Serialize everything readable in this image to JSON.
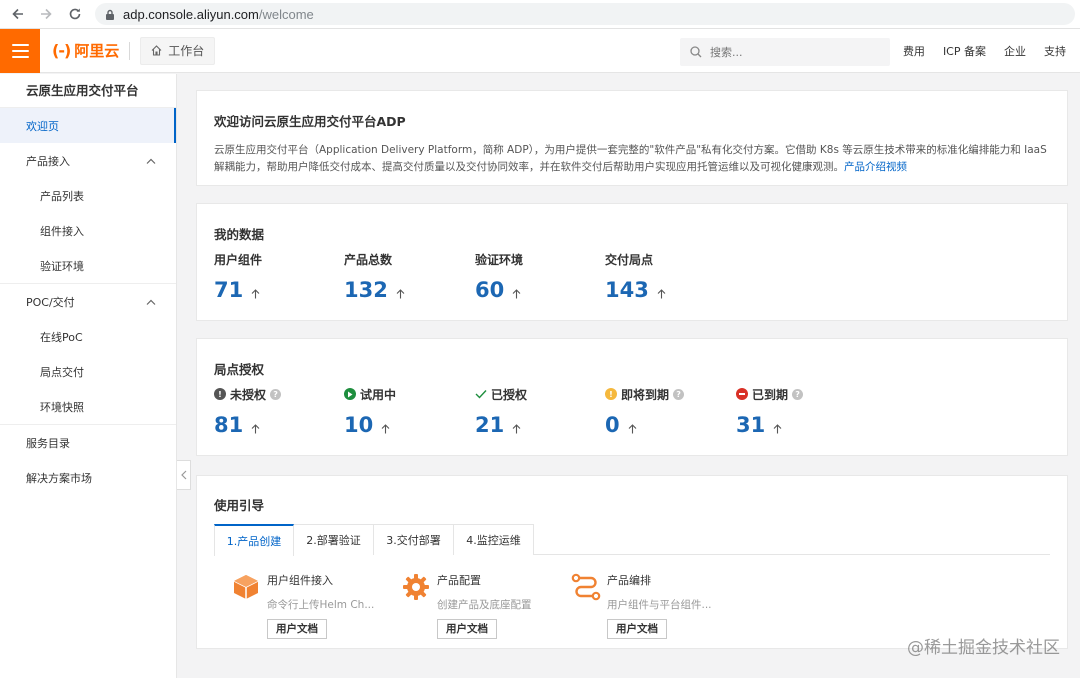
{
  "browser": {
    "url_host": "adp.console.aliyun.com",
    "url_path": "/welcome"
  },
  "topnav": {
    "logo_mark": "(-)",
    "logo_text": "阿里云",
    "workbench_label": "工作台",
    "search_placeholder": "搜索...",
    "links": [
      "费用",
      "ICP 备案",
      "企业",
      "支持"
    ]
  },
  "sidebar": {
    "title": "云原生应用交付平台",
    "items": [
      {
        "label": "欢迎页",
        "active": true
      },
      {
        "label": "产品接入",
        "group": true
      },
      {
        "label": "产品列表"
      },
      {
        "label": "组件接入"
      },
      {
        "label": "验证环境"
      },
      {
        "label": "POC/交付",
        "group": true
      },
      {
        "label": "在线PoC"
      },
      {
        "label": "局点交付"
      },
      {
        "label": "环境快照"
      },
      {
        "label": "服务目录"
      },
      {
        "label": "解决方案市场"
      }
    ]
  },
  "welcome": {
    "title": "欢迎访问云原生应用交付平台ADP",
    "body": "云原生应用交付平台（Application Delivery Platform，简称 ADP），为用户提供一套完整的\"软件产品\"私有化交付方案。它借助 K8s 等云原生技术带来的标准化编排能力和 IaaS 解耦能力，帮助用户降低交付成本、提高交付质量以及交付协同效率，并在软件交付后帮助用户实现应用托管运维以及可视化健康观测。",
    "link": "产品介绍视频"
  },
  "my_data": {
    "title": "我的数据",
    "stats": [
      {
        "label": "用户组件",
        "value": "71"
      },
      {
        "label": "产品总数",
        "value": "132"
      },
      {
        "label": "验证环境",
        "value": "60"
      },
      {
        "label": "交付局点",
        "value": "143"
      }
    ]
  },
  "license": {
    "title": "局点授权",
    "stats": [
      {
        "label": "未授权",
        "value": "81",
        "icon": "exclamation-icon",
        "color": "#555555"
      },
      {
        "label": "试用中",
        "value": "10",
        "icon": "play-icon",
        "color": "#1e8e3e"
      },
      {
        "label": "已授权",
        "value": "21",
        "icon": "check-icon",
        "color": "#1e8e3e"
      },
      {
        "label": "即将到期",
        "value": "0",
        "icon": "warning-icon",
        "color": "#f5b83d"
      },
      {
        "label": "已到期",
        "value": "31",
        "icon": "stop-icon",
        "color": "#d93026"
      }
    ]
  },
  "guide": {
    "title": "使用引导",
    "tabs": [
      "1.产品创建",
      "2.部署验证",
      "3.交付部署",
      "4.监控运维"
    ],
    "items": [
      {
        "title": "用户组件接入",
        "desc": "命令行上传Helm Ch...",
        "button": "用户文档",
        "icon": "cube-icon"
      },
      {
        "title": "产品配置",
        "desc": "创建产品及底座配置",
        "button": "用户文档",
        "icon": "gear-icon"
      },
      {
        "title": "产品编排",
        "desc": "用户组件与平台组件...",
        "button": "用户文档",
        "icon": "flow-icon"
      }
    ]
  },
  "watermark": "@稀土掘金技术社区",
  "colors": {
    "accent": "#ff6a00",
    "link": "#0064c8",
    "value": "#1c67b3"
  }
}
